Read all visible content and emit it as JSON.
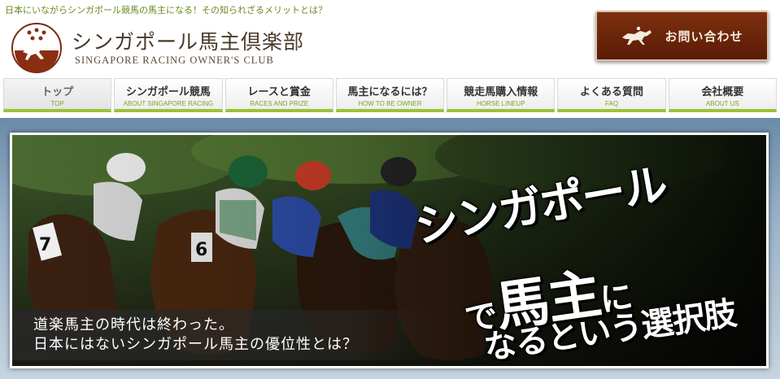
{
  "header": {
    "tagline": "日本にいながらシンガポール競馬の馬主になる！その知られざるメリットとは？",
    "logo_title": "シンガポール馬主倶楽部",
    "logo_subtitle": "SINGAPORE RACING OWNER'S CLUB",
    "contact_label": "お問い合わせ"
  },
  "nav": {
    "items": [
      {
        "label": "トップ",
        "sub": "TOP"
      },
      {
        "label": "シンガポール競馬",
        "sub": "ABOUT SINGAPORE RACING"
      },
      {
        "label": "レースと賞金",
        "sub": "RACES AND PRIZE"
      },
      {
        "label": "馬主になるには？",
        "sub": "HOW TO BE OWNER"
      },
      {
        "label": "競走馬購入情報",
        "sub": "HORSE LINEUP"
      },
      {
        "label": "よくある質問",
        "sub": "FAQ"
      },
      {
        "label": "会社概要",
        "sub": "ABOUT US"
      }
    ]
  },
  "hero": {
    "caption_line1": "道楽馬主の時代は終わった。",
    "caption_line2": "日本にはないシンガポール馬主の優位性とは？",
    "slogan_line1": "シンガポール",
    "slogan_line2_small": "で",
    "slogan_line2_big": "馬主",
    "slogan_line2_end": "に",
    "slogan_line3": "なるという選択肢",
    "saddle_numbers": [
      "7",
      "6"
    ]
  },
  "colors": {
    "accent_green": "#9cc23a",
    "tagline_green": "#6a8a1f",
    "contact_brown": "#6b2509"
  }
}
